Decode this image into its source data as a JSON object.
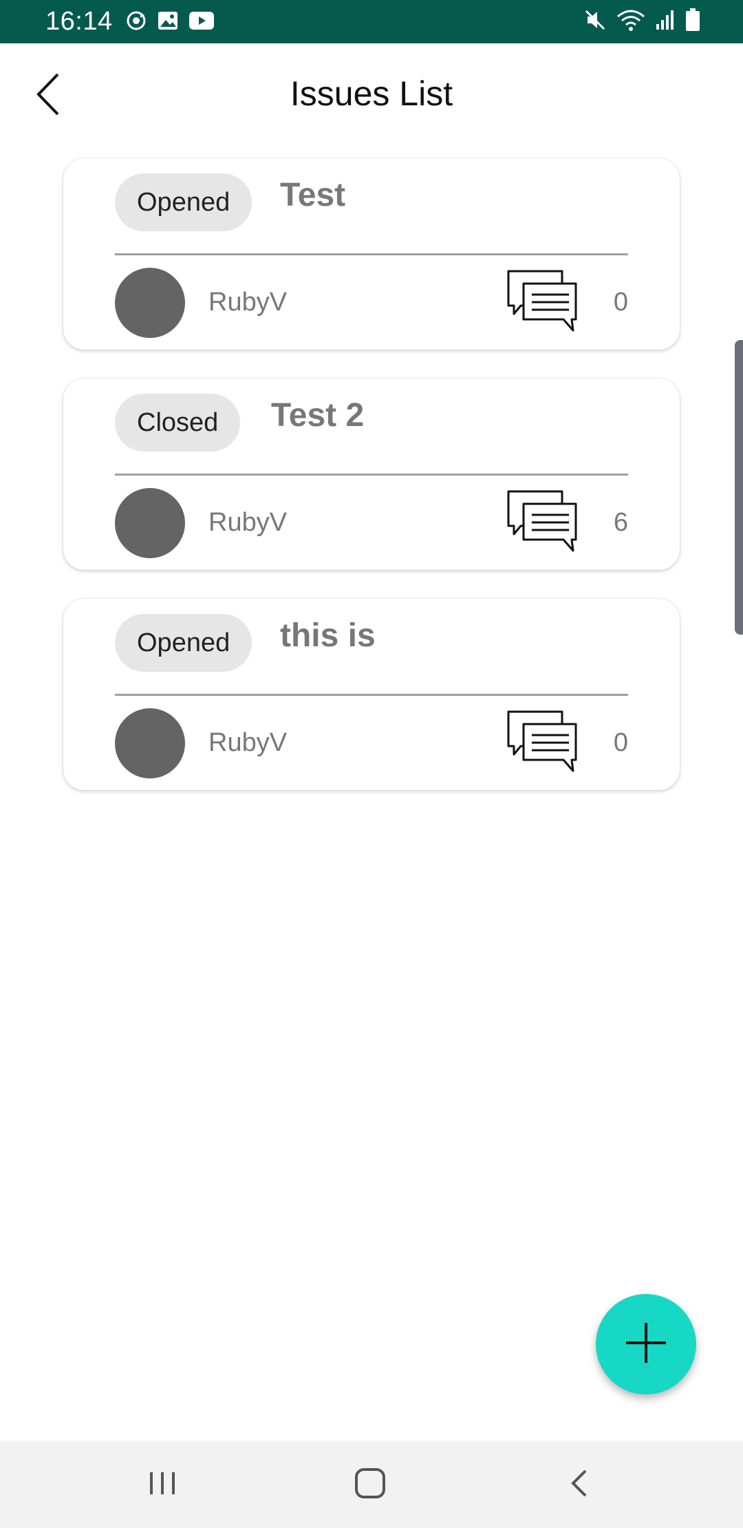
{
  "status_bar": {
    "time": "16:14",
    "background": "#055a4e",
    "left_icons": [
      "sync-icon",
      "image-icon",
      "youtube-icon"
    ],
    "right_icons": [
      "mute-icon",
      "wifi-icon",
      "signal-icon",
      "battery-icon"
    ]
  },
  "header": {
    "title": "Issues List",
    "back_icon": "chevron-left-icon"
  },
  "issues": [
    {
      "status": "Opened",
      "title": "Test",
      "author": "RubyV",
      "comment_count": "0"
    },
    {
      "status": "Closed",
      "title": "Test 2",
      "author": "RubyV",
      "comment_count": "6"
    },
    {
      "status": "Opened",
      "title": "this is",
      "author": "RubyV",
      "comment_count": "0"
    }
  ],
  "fab": {
    "icon": "plus-icon",
    "color": "#16d8c4"
  },
  "nav_bar": {
    "icons": [
      "recent-apps-icon",
      "home-icon",
      "system-back-icon"
    ]
  }
}
